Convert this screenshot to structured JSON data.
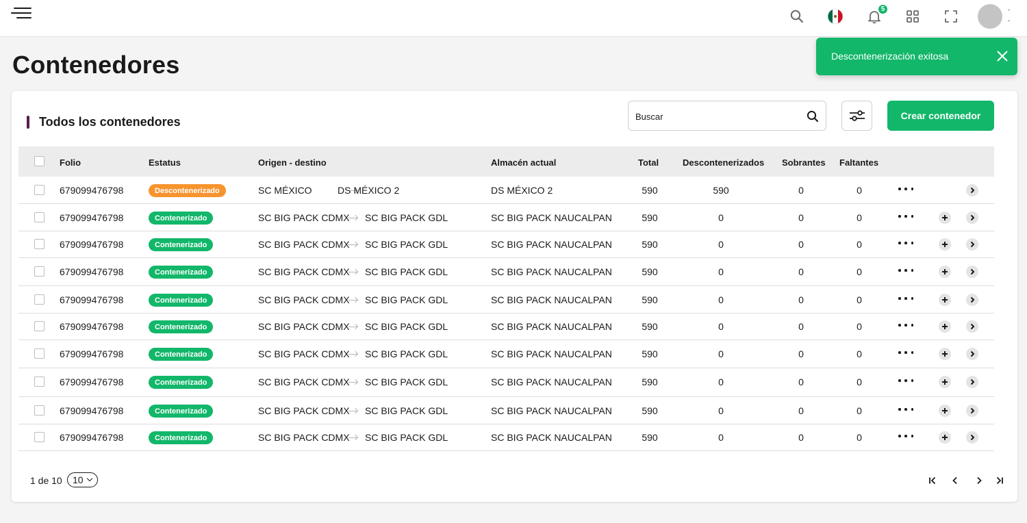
{
  "header": {
    "icons": [
      "menu-icon",
      "search-icon",
      "mexico-flag-icon",
      "bell-icon",
      "grid-icon",
      "fullscreen-icon"
    ],
    "notification_count": "5"
  },
  "page": {
    "title": "Contenedores"
  },
  "toast": {
    "message": "Descontenerización exitosa",
    "color": "#12b76a"
  },
  "card": {
    "title": "Todos los contenedores",
    "search_placeholder": "Buscar",
    "create_label": "Crear contenedor",
    "accent": "#5b1a4f"
  },
  "table": {
    "headers": {
      "folio": "Folio",
      "estatus": "Estatus",
      "origen": "Origen - destino",
      "almacen": "Almacén actual",
      "total": "Total",
      "descontenerizados": "Descontenerizados",
      "sobrantes": "Sobrantes",
      "faltantes": "Faltantes"
    },
    "status_colors": {
      "Descontenerizado": "#f7942e",
      "Contenerizado": "#12b76a"
    },
    "rows": [
      {
        "folio": "679099476798",
        "estatus": "Descontenerizado",
        "origen": "SC MÉXICO",
        "destino": "DS MÉXICO 2",
        "almacen": "DS MÉXICO 2",
        "total": "590",
        "descontenerizados": "590",
        "sobrantes": "0",
        "faltantes": "0",
        "add": false
      },
      {
        "folio": "679099476798",
        "estatus": "Contenerizado",
        "origen": "SC BIG PACK CDMX",
        "destino": "SC BIG PACK GDL",
        "almacen": "SC BIG PACK NAUCALPAN",
        "total": "590",
        "descontenerizados": "0",
        "sobrantes": "0",
        "faltantes": "0",
        "add": true
      },
      {
        "folio": "679099476798",
        "estatus": "Contenerizado",
        "origen": "SC BIG PACK CDMX",
        "destino": "SC BIG PACK GDL",
        "almacen": "SC BIG PACK NAUCALPAN",
        "total": "590",
        "descontenerizados": "0",
        "sobrantes": "0",
        "faltantes": "0",
        "add": true
      },
      {
        "folio": "679099476798",
        "estatus": "Contenerizado",
        "origen": "SC BIG PACK CDMX",
        "destino": "SC BIG PACK GDL",
        "almacen": "SC BIG PACK NAUCALPAN",
        "total": "590",
        "descontenerizados": "0",
        "sobrantes": "0",
        "faltantes": "0",
        "add": true
      },
      {
        "folio": "679099476798",
        "estatus": "Contenerizado",
        "origen": "SC BIG PACK CDMX",
        "destino": "SC BIG PACK GDL",
        "almacen": "SC BIG PACK NAUCALPAN",
        "total": "590",
        "descontenerizados": "0",
        "sobrantes": "0",
        "faltantes": "0",
        "add": true
      },
      {
        "folio": "679099476798",
        "estatus": "Contenerizado",
        "origen": "SC BIG PACK CDMX",
        "destino": "SC BIG PACK GDL",
        "almacen": "SC BIG PACK NAUCALPAN",
        "total": "590",
        "descontenerizados": "0",
        "sobrantes": "0",
        "faltantes": "0",
        "add": true
      },
      {
        "folio": "679099476798",
        "estatus": "Contenerizado",
        "origen": "SC BIG PACK CDMX",
        "destino": "SC BIG PACK GDL",
        "almacen": "SC BIG PACK NAUCALPAN",
        "total": "590",
        "descontenerizados": "0",
        "sobrantes": "0",
        "faltantes": "0",
        "add": true
      },
      {
        "folio": "679099476798",
        "estatus": "Contenerizado",
        "origen": "SC BIG PACK CDMX",
        "destino": "SC BIG PACK GDL",
        "almacen": "SC BIG PACK NAUCALPAN",
        "total": "590",
        "descontenerizados": "0",
        "sobrantes": "0",
        "faltantes": "0",
        "add": true
      },
      {
        "folio": "679099476798",
        "estatus": "Contenerizado",
        "origen": "SC BIG PACK CDMX",
        "destino": "SC BIG PACK GDL",
        "almacen": "SC BIG PACK NAUCALPAN",
        "total": "590",
        "descontenerizados": "0",
        "sobrantes": "0",
        "faltantes": "0",
        "add": true
      },
      {
        "folio": "679099476798",
        "estatus": "Contenerizado",
        "origen": "SC BIG PACK CDMX",
        "destino": "SC BIG PACK GDL",
        "almacen": "SC BIG PACK NAUCALPAN",
        "total": "590",
        "descontenerizados": "0",
        "sobrantes": "0",
        "faltantes": "0",
        "add": true
      }
    ]
  },
  "pagination": {
    "label": "1 de 10",
    "page_size": "10"
  }
}
